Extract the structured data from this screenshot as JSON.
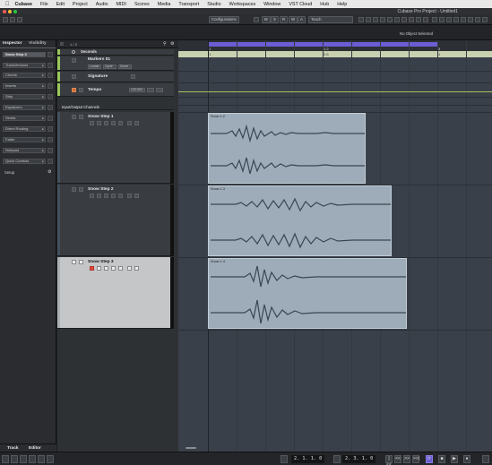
{
  "menubar": {
    "items": [
      "Cubase",
      "File",
      "Edit",
      "Project",
      "Audio",
      "MIDI",
      "Scores",
      "Media",
      "Transport",
      "Studio",
      "Workspaces",
      "Window",
      "VST Cloud",
      "Hub",
      "Help"
    ]
  },
  "window": {
    "title": "Cubase Pro Project - Untitled1"
  },
  "toolbar": {
    "configurations": "Configurations",
    "automation_mode": "Touch",
    "toggles": [
      "M",
      "S",
      "R",
      "W",
      "A"
    ]
  },
  "infoline": {
    "status": "No Object Selected"
  },
  "inspector": {
    "tab_inspector": "Inspector",
    "tab_visibility": "Visibility",
    "track_name": "Snow Step 3",
    "sections": [
      "TrackVersions",
      "Chords",
      "Inserts",
      "Strip",
      "Equalizers",
      "Sends",
      "Direct Routing",
      "Fader",
      "Notepad",
      "Quick Controls"
    ],
    "setup": "Setup",
    "bottom_tab_track": "Track",
    "bottom_tab_editor": "Editor"
  },
  "tracklist": {
    "header_count": "1 / 3",
    "ruler_track": "Seconds",
    "marker_track": "Markers 01",
    "marker_buttons": [
      "Locate",
      "Cycle",
      "Zoom"
    ],
    "signature_track": "Signature",
    "tempo_track": "Tempo",
    "tempo_value": "120.000",
    "folder": "Input/Output Channels",
    "audio_tracks": [
      {
        "name": "Snow Step 1",
        "color": "#3a4554"
      },
      {
        "name": "Snow Step 2",
        "color": "#3a4554"
      },
      {
        "name": "Snow Step 3",
        "color": "#c7c9cb"
      }
    ]
  },
  "project": {
    "ruler_labels": [
      "1",
      "1.2",
      "2",
      "3"
    ],
    "ruler_sub_labels": [
      "1",
      "0.5",
      "1"
    ],
    "clips": [
      {
        "name": "Snow 1.2"
      },
      {
        "name": "Snow 1.3"
      },
      {
        "name": "Snow 1.4"
      }
    ],
    "colors": {
      "cycle_bar": "#6b5dd3",
      "tempo_strip": "#a8c060",
      "clip": "#9eacb9"
    }
  },
  "transport": {
    "left_locator": "2. 1. 1.  0",
    "right_locator": "2. 3. 1.  0",
    "buttons": [
      "|<<",
      "<<",
      ">>",
      ">>|",
      "cycle",
      "stop",
      "play",
      "record"
    ]
  }
}
